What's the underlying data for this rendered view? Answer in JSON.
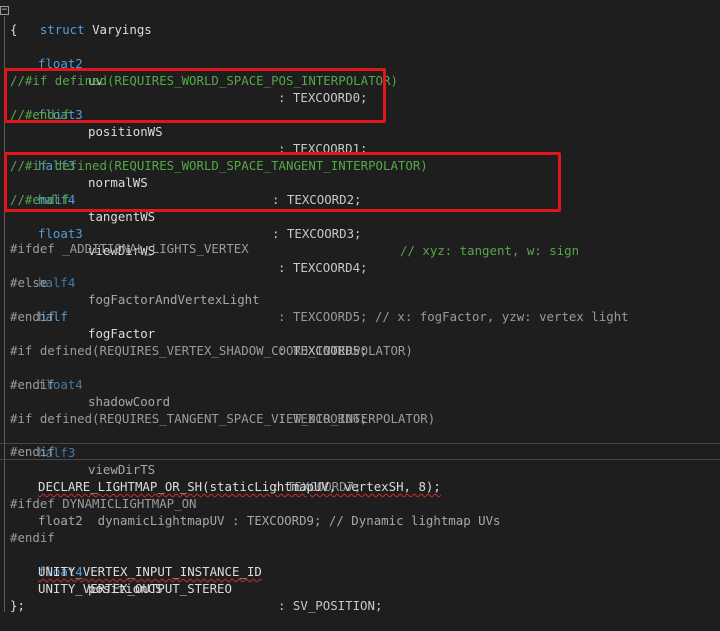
{
  "editor": {
    "lines": [
      {
        "t": "struct Varyings"
      },
      {
        "t": "{"
      },
      {
        "type": "float2",
        "name": "uv",
        "sem": ": TEXCOORD0;"
      },
      {
        "t": ""
      },
      {
        "t": "//#if defined(REQUIRES_WORLD_SPACE_POS_INTERPOLATOR)"
      },
      {
        "type": "float3",
        "name": "positionWS",
        "sem": ": TEXCOORD1;"
      },
      {
        "t": "//#endif"
      },
      {
        "t": ""
      },
      {
        "type": "half3",
        "name": "normalWS",
        "sem": ": TEXCOORD2;"
      },
      {
        "t": "//#if defined(REQUIRES_WORLD_SPACE_TANGENT_INTERPOLATOR)"
      },
      {
        "type": "half4",
        "name": "tangentWS",
        "sem": ": TEXCOORD3;",
        "comment": "// xyz: tangent, w: sign"
      },
      {
        "t": "//#endif"
      },
      {
        "type": "float3",
        "name": "viewDirWS",
        "sem": ": TEXCOORD4;"
      },
      {
        "t": ""
      },
      {
        "t": "#ifdef _ADDITIONAL_LIGHTS_VERTEX"
      },
      {
        "type": "half4",
        "name": "fogFactorAndVertexLight",
        "sem": ": TEXCOORD5; // x: fogFactor, yzw: vertex light"
      },
      {
        "t": "#else"
      },
      {
        "type": "half",
        "name": "fogFactor",
        "sem": ": TEXCOORD5;"
      },
      {
        "t": "#endif"
      },
      {
        "t": ""
      },
      {
        "t": "#if defined(REQUIRES_VERTEX_SHADOW_COORD_INTERPOLATOR)"
      },
      {
        "type": "float4",
        "name": "shadowCoord",
        "sem": ": TEXCOORD6;"
      },
      {
        "t": "#endif"
      },
      {
        "t": ""
      },
      {
        "t": "#if defined(REQUIRES_TANGENT_SPACE_VIEW_DIR_INTERPOLATOR)"
      },
      {
        "type": "half3",
        "name": "viewDirTS",
        "sem": ": TEXCOORD7;"
      },
      {
        "t": "#endif"
      },
      {
        "t": ""
      },
      {
        "t": "DECLARE_LIGHTMAP_OR_SH(staticLightmapUV, vertexSH, 8);"
      },
      {
        "t": "#ifdef DYNAMICLIGHTMAP_ON"
      },
      {
        "t": "float2  dynamicLightmapUV : TEXCOORD9; // Dynamic lightmap UVs"
      },
      {
        "t": "#endif"
      },
      {
        "type": "float4",
        "name": "positionCS",
        "sem": ": SV_POSITION;"
      },
      {
        "t": "UNITY_VERTEX_INPUT_INSTANCE_ID"
      },
      {
        "t": "UNITY_VERTEX_OUTPUT_STEREO"
      },
      {
        "t": "};"
      }
    ],
    "fold_glyph": "−"
  },
  "colors": {
    "background": "#1e1e1e",
    "keyword": "#569cd6",
    "comment": "#57a64a",
    "preprocessor": "#9b9b9b",
    "highlight_box": "#e0161d"
  }
}
